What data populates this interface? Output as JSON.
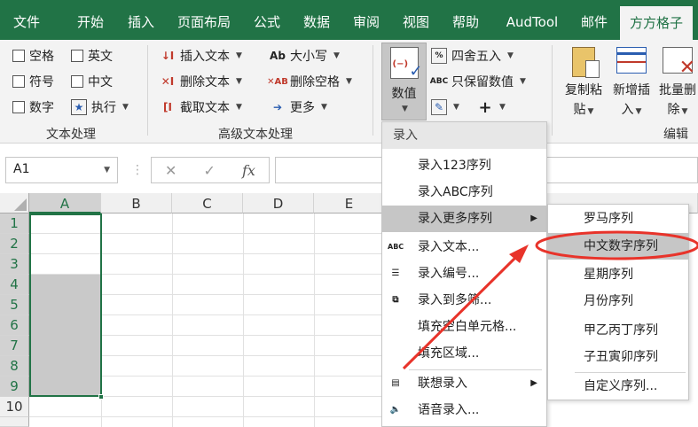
{
  "tabs": [
    "文件",
    "开始",
    "插入",
    "页面布局",
    "公式",
    "数据",
    "审阅",
    "视图",
    "帮助",
    "AudTool",
    "邮件",
    "方方格子"
  ],
  "ribbon": {
    "text_proc": {
      "checkboxes": [
        "空格",
        "英文",
        "符号",
        "中文",
        "数字"
      ],
      "execute": "执行",
      "group_label": "文本处理"
    },
    "adv_text": {
      "insert_text": "插入文本",
      "delete_text": "删除文本",
      "extract_text": "截取文本",
      "case": "大小写",
      "delete_spaces": "删除空格",
      "more": "更多",
      "group_label": "高级文本处理"
    },
    "numeric": {
      "label": "数值",
      "round": "四舍五入",
      "keep_values": "只保留数值"
    },
    "edit": {
      "copy_paste": [
        "复制粘",
        "贴"
      ],
      "add_insert": [
        "新增插",
        "入"
      ],
      "batch_delete": [
        "批量删",
        "除"
      ],
      "group_label": "编辑"
    }
  },
  "formula_bar": {
    "name_box": "A1",
    "fx": "fx"
  },
  "grid": {
    "columns": [
      "A",
      "B",
      "C",
      "D",
      "E"
    ],
    "rows": [
      "1",
      "2",
      "3",
      "4",
      "5",
      "6",
      "7",
      "8",
      "9",
      "10"
    ]
  },
  "menu": {
    "header": "录入",
    "items": [
      "录入123序列",
      "录入ABC序列",
      "录入更多序列",
      "录入文本...",
      "录入编号...",
      "录入到多筛...",
      "填充空白单元格...",
      "填充区域...",
      "联想录入",
      "语音录入..."
    ],
    "icon_abc": "ABC"
  },
  "submenu": {
    "items": [
      "罗马序列",
      "中文数字序列",
      "星期序列",
      "月份序列",
      "甲乙丙丁序列",
      "子丑寅卯序列",
      "自定义序列..."
    ]
  },
  "colors": {
    "accent": "#217346",
    "highlight": "#c6c6c6",
    "annotation": "#e8332a"
  }
}
